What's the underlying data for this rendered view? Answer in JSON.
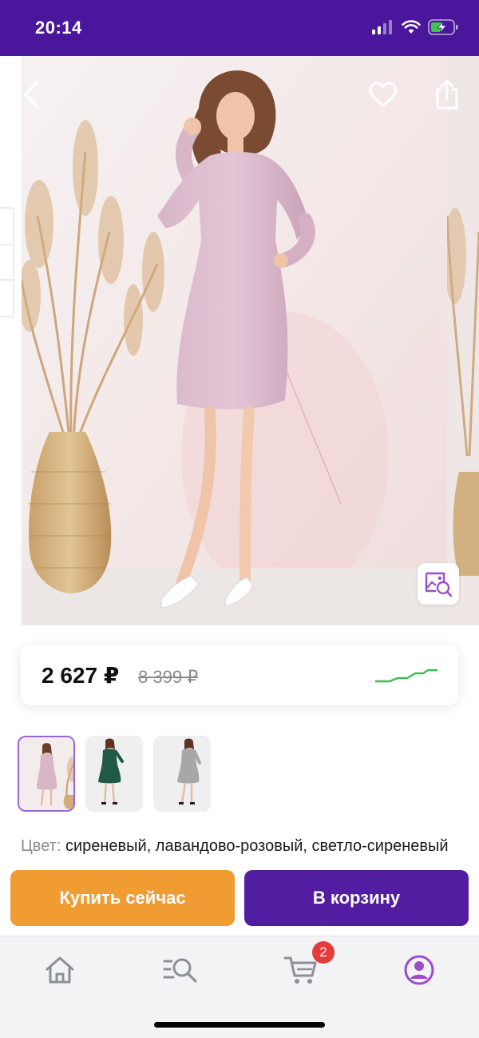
{
  "status_bar": {
    "time": "20:14",
    "icons": [
      "cellular-signal-icon",
      "wifi-icon",
      "battery-charging-icon"
    ]
  },
  "product": {
    "image_alt": "lilac long-sleeve dress",
    "price_current": "2 627 ₽",
    "price_old": "8 399 ₽",
    "color_label": "Цвет:",
    "color_value": "сиреневый, лавандово-розовый, светло-сиреневый"
  },
  "thumbnails": [
    {
      "dress_color": "#d9b6c6",
      "selected": true
    },
    {
      "dress_color": "#1f5a45",
      "selected": false
    },
    {
      "dress_color": "#a7a7ab",
      "selected": false
    }
  ],
  "actions": {
    "buy_now": "Купить сейчас",
    "add_to_cart": "В корзину"
  },
  "tab_bar": {
    "items": [
      {
        "icon": "home-icon"
      },
      {
        "icon": "catalog-search-icon"
      },
      {
        "icon": "cart-icon"
      },
      {
        "icon": "profile-icon"
      }
    ],
    "cart_badge": "2"
  },
  "colors": {
    "header": "#4a169b",
    "buy_now": "#f19c33",
    "add_to_cart": "#521da1",
    "accent": "#9b4dca",
    "badge": "#e53b3b",
    "price_trend": "#3dbb4e"
  }
}
